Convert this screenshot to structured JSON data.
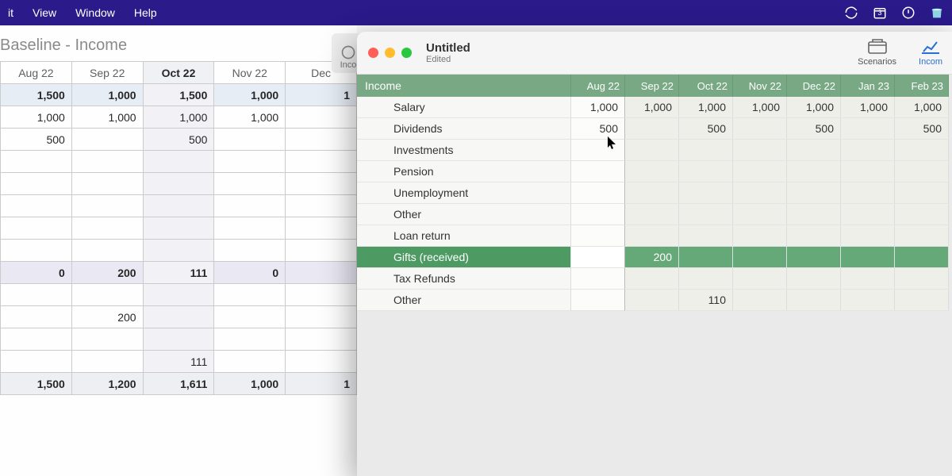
{
  "menubar": {
    "items": [
      "it",
      "View",
      "Window",
      "Help"
    ],
    "rightIcons": [
      "sync-icon",
      "calendar-icon",
      "power-icon",
      "trash-icon"
    ],
    "calendarBadge": "3"
  },
  "bgWindow": {
    "title": "Baseline - Income",
    "columns": [
      "Aug 22",
      "Sep 22",
      "Oct 22",
      "Nov 22",
      "Dec"
    ],
    "selectedCol": 2,
    "rows": [
      {
        "cells": [
          "1,500",
          "1,000",
          "1,500",
          "1,000",
          "1"
        ],
        "bold": true,
        "tint": "blue"
      },
      {
        "cells": [
          "1,000",
          "1,000",
          "1,000",
          "1,000",
          ""
        ],
        "tint": ""
      },
      {
        "cells": [
          "500",
          "",
          "500",
          "",
          ""
        ],
        "tint": ""
      },
      {
        "cells": [
          "",
          "",
          "",
          "",
          ""
        ],
        "tint": "gray"
      },
      {
        "cells": [
          "",
          "",
          "",
          "",
          ""
        ]
      },
      {
        "cells": [
          "",
          "",
          "",
          "",
          ""
        ]
      },
      {
        "cells": [
          "",
          "",
          "",
          "",
          ""
        ]
      },
      {
        "cells": [
          "",
          "",
          "",
          "",
          ""
        ]
      },
      {
        "cells": [
          "0",
          "200",
          "111",
          "0",
          ""
        ],
        "bold": true,
        "tint": "lav"
      },
      {
        "cells": [
          "",
          "",
          "",
          "",
          ""
        ]
      },
      {
        "cells": [
          "",
          "200",
          "",
          "",
          ""
        ]
      },
      {
        "cells": [
          "",
          "",
          "",
          "",
          ""
        ]
      },
      {
        "cells": [
          "",
          "",
          "111",
          "",
          ""
        ]
      },
      {
        "cells": [
          "1,500",
          "1,200",
          "1,611",
          "1,000",
          "1"
        ],
        "bold": true,
        "totals": true
      }
    ]
  },
  "fgWindow": {
    "title": "Untitled",
    "subtitle": "Edited",
    "toolbar": [
      {
        "label": "Scenarios",
        "icon": "scenarios-icon"
      },
      {
        "label": "Incom",
        "icon": "income-icon"
      }
    ],
    "header": "Income",
    "columns": [
      "Aug 22",
      "Sep 22",
      "Oct 22",
      "Nov 22",
      "Dec 22",
      "Jan 23",
      "Feb 23"
    ],
    "rows": [
      {
        "label": "Salary",
        "cells": [
          "1,000",
          "1,000",
          "1,000",
          "1,000",
          "1,000",
          "1,000",
          "1,000"
        ]
      },
      {
        "label": "Dividends",
        "cells": [
          "500",
          "",
          "500",
          "",
          "500",
          "",
          "500"
        ]
      },
      {
        "label": "Investments",
        "cells": [
          "",
          "",
          "",
          "",
          "",
          "",
          ""
        ]
      },
      {
        "label": "Pension",
        "cells": [
          "",
          "",
          "",
          "",
          "",
          "",
          ""
        ]
      },
      {
        "label": "Unemployment",
        "cells": [
          "",
          "",
          "",
          "",
          "",
          "",
          ""
        ]
      },
      {
        "label": "Other",
        "cells": [
          "",
          "",
          "",
          "",
          "",
          "",
          ""
        ]
      },
      {
        "label": "Loan return",
        "cells": [
          "",
          "",
          "",
          "",
          "",
          "",
          ""
        ]
      },
      {
        "label": "Gifts (received)",
        "cells": [
          "",
          "200",
          "",
          "",
          "",
          "",
          ""
        ],
        "selected": true
      },
      {
        "label": "Tax Refunds",
        "cells": [
          "",
          "",
          "",
          "",
          "",
          "",
          ""
        ]
      },
      {
        "label": "Other",
        "cells": [
          "",
          "",
          "110",
          "",
          "",
          "",
          ""
        ]
      }
    ]
  },
  "tabBehind": {
    "label": "Inco"
  }
}
